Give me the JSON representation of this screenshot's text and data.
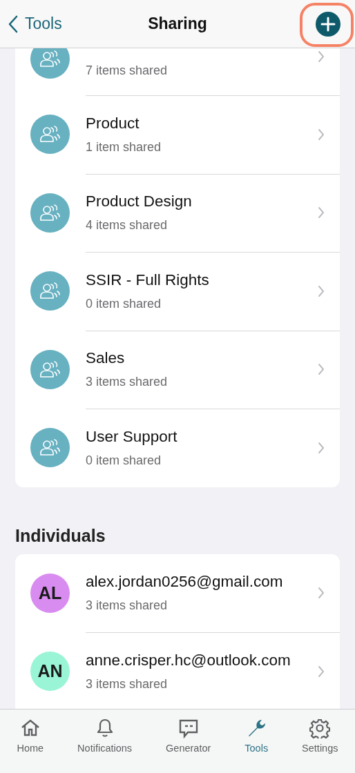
{
  "header": {
    "back_label": "Tools",
    "title": "Sharing",
    "add_button": {
      "highlighted": true
    }
  },
  "groups": [
    {
      "subtitle": "7 items shared",
      "partial": true
    },
    {
      "title": "Product",
      "subtitle": "1 item shared",
      "partial": false
    },
    {
      "title": "Product Design",
      "subtitle": "4 items shared",
      "partial": false
    },
    {
      "title": "SSIR - Full Rights",
      "subtitle": "0 item shared",
      "partial": false
    },
    {
      "title": "Sales",
      "subtitle": "3 items shared",
      "partial": false
    },
    {
      "title": "User Support",
      "subtitle": "0 item shared",
      "partial": false
    }
  ],
  "individuals": {
    "heading": "Individuals",
    "items": [
      {
        "initials": "AL",
        "email": "alex.jordan0256@gmail.com",
        "subtitle": "3 items shared",
        "color": "#d98cf0"
      },
      {
        "initials": "AN",
        "email": "anne.crisper.hc@outlook.com",
        "subtitle": "3 items shared",
        "color": "#9af5d6"
      }
    ]
  },
  "tab_bar": [
    {
      "kind": "home",
      "label": "Home",
      "selected": false
    },
    {
      "kind": "bell",
      "label": "Notifications",
      "selected": false
    },
    {
      "kind": "chat",
      "label": "Generator",
      "selected": false
    },
    {
      "kind": "wrench",
      "label": "Tools",
      "selected": true
    },
    {
      "kind": "gear",
      "label": "Settings",
      "selected": false
    }
  ]
}
